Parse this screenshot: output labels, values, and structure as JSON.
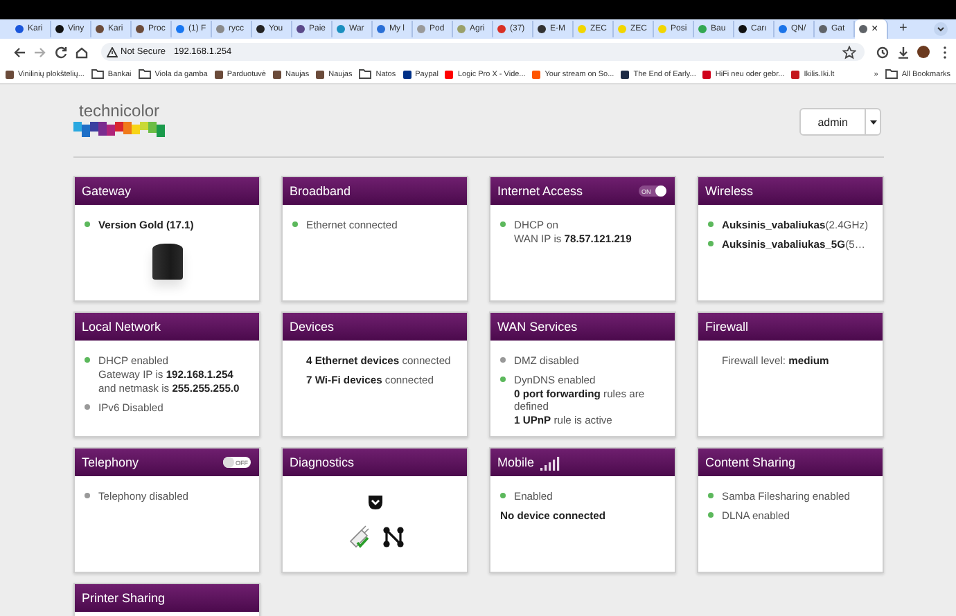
{
  "browser": {
    "tabs": [
      {
        "label": "Kari",
        "color": "#1a56db",
        "selected": false
      },
      {
        "label": "Viny",
        "color": "#111111",
        "selected": false
      },
      {
        "label": "Kari",
        "color": "#6b4b3a",
        "selected": false
      },
      {
        "label": "Proc",
        "color": "#6b4b3a",
        "selected": false
      },
      {
        "label": "(1) F",
        "color": "#1877f2",
        "selected": false
      },
      {
        "label": "rycc",
        "color": "#8a8a8a",
        "selected": false
      },
      {
        "label": "You",
        "color": "#222222",
        "selected": false
      },
      {
        "label": "Paie",
        "color": "#5b4a8a",
        "selected": false
      },
      {
        "label": "War",
        "color": "#1a8fbf",
        "selected": false
      },
      {
        "label": "My l",
        "color": "#2a6fd6",
        "selected": false
      },
      {
        "label": "Pod",
        "color": "#9a9a9a",
        "selected": false
      },
      {
        "label": "Agri",
        "color": "#9aa06a",
        "selected": false
      },
      {
        "label": "(37)",
        "color": "#d93025",
        "selected": false
      },
      {
        "label": "E-M",
        "color": "#333333",
        "selected": false
      },
      {
        "label": "ZEC",
        "color": "#f2d600",
        "selected": false
      },
      {
        "label": "ZEC",
        "color": "#f2d600",
        "selected": false
      },
      {
        "label": "Posi",
        "color": "#f2d600",
        "selected": false
      },
      {
        "label": "Bau",
        "color": "#34a853",
        "selected": false
      },
      {
        "label": "Carı",
        "color": "#111111",
        "selected": false
      },
      {
        "label": "QN/",
        "color": "#1a73e8",
        "selected": false
      },
      {
        "label": "Gat",
        "color": "#5f6368",
        "selected": false
      },
      {
        "color": "#5f6368",
        "close": "×",
        "selected": true
      }
    ],
    "new_tab": "+",
    "security": "Not Secure",
    "url": "192.168.1.254",
    "bookmarks": [
      {
        "label": "Vinilinių plokštelių...",
        "kind": "site",
        "color": "#6b4b3a"
      },
      {
        "label": "Bankai",
        "kind": "folder"
      },
      {
        "label": "Viola da gamba",
        "kind": "folder"
      },
      {
        "label": "Parduotuvė",
        "kind": "site",
        "color": "#6b4b3a"
      },
      {
        "label": "Naujas",
        "kind": "site",
        "color": "#6b4b3a"
      },
      {
        "label": "Naujas",
        "kind": "site",
        "color": "#6b4b3a"
      },
      {
        "label": "Natos",
        "kind": "folder"
      },
      {
        "label": "Paypal",
        "kind": "site",
        "color": "#003087"
      },
      {
        "label": "Logic Pro X - Vide...",
        "kind": "site",
        "color": "#ff0000"
      },
      {
        "label": "Your stream on So...",
        "kind": "site",
        "color": "#ff5500"
      },
      {
        "label": "The End of Early...",
        "kind": "site",
        "color": "#1c2a44"
      },
      {
        "label": "HiFi neu oder gebr...",
        "kind": "site",
        "color": "#d0021b"
      },
      {
        "label": "Ikilis.Iki.lt",
        "kind": "site",
        "color": "#c4161c"
      }
    ],
    "bookmarks_overflow": "»",
    "all_bookmarks": "All Bookmarks"
  },
  "header": {
    "logo": "technicolor",
    "user": "admin"
  },
  "cards": [
    {
      "title": "Gateway",
      "kind": "device",
      "items": [
        {
          "kind": "dot",
          "color": "#5cb85c",
          "text": "Version Gold (17.1)",
          "bold": true
        }
      ]
    },
    {
      "title": "Broadband",
      "kind": "status",
      "items": [
        {
          "kind": "dot",
          "color": "#5cb85c",
          "text": "Ethernet connected"
        }
      ]
    },
    {
      "title": "Internet Access",
      "kind": "status",
      "toggle": {
        "label": "ON",
        "on": true
      },
      "items": [
        {
          "kind": "dot",
          "color": "#5cb85c",
          "text": "DHCP on",
          "details": [
            "WAN IP is **78.57.121.219**"
          ]
        }
      ]
    },
    {
      "title": "Wireless",
      "kind": "status",
      "items": [
        {
          "kind": "dot",
          "color": "#5cb85c",
          "text": "**Auksinis_vabaliukas**(2.4GHz)"
        },
        {
          "kind": "dot",
          "color": "#5cb85c",
          "text": "**Auksinis_vabaliukas_5G**(5…"
        }
      ]
    },
    {
      "title": "Local Network",
      "kind": "status",
      "items": [
        {
          "kind": "dot",
          "color": "#5cb85c",
          "text": "DHCP enabled",
          "details": [
            "Gateway IP is **192.168.1.254**",
            "and netmask is **255.255.255.0**"
          ]
        },
        {
          "kind": "dot",
          "color": "#999999",
          "text": "IPv6 Disabled"
        }
      ]
    },
    {
      "title": "Devices",
      "kind": "status",
      "items": [
        {
          "kind": "indent",
          "text": "**4 Ethernet devices** connected"
        },
        {
          "kind": "indent",
          "text": "**7 Wi-Fi devices** connected"
        }
      ]
    },
    {
      "title": "WAN Services",
      "kind": "status",
      "items": [
        {
          "kind": "dot",
          "color": "#999999",
          "text": "DMZ disabled"
        },
        {
          "kind": "dot",
          "color": "#5cb85c",
          "text": "DynDNS enabled",
          "details": [
            "**0 port forwarding** rules are defined",
            "**1 UPnP** rule is active"
          ]
        }
      ]
    },
    {
      "title": "Firewall",
      "kind": "status",
      "items": [
        {
          "kind": "indent",
          "text": "Firewall level: **medium**"
        }
      ]
    },
    {
      "title": "Telephony",
      "kind": "status",
      "toggle": {
        "label": "OFF",
        "on": false
      },
      "items": [
        {
          "kind": "dot",
          "color": "#999999",
          "text": "Telephony disabled"
        }
      ]
    },
    {
      "title": "Diagnostics",
      "kind": "diagnostics"
    },
    {
      "title": "Mobile",
      "kind": "status",
      "signal_icon": true,
      "items": [
        {
          "kind": "dot",
          "color": "#5cb85c",
          "text": "Enabled"
        },
        {
          "kind": "flush",
          "text": "No device connected",
          "bold": true
        }
      ]
    },
    {
      "title": "Content Sharing",
      "kind": "status",
      "items": [
        {
          "kind": "dot",
          "color": "#5cb85c",
          "text": "Samba Filesharing enabled"
        },
        {
          "kind": "dot",
          "color": "#5cb85c",
          "text": "DLNA enabled"
        }
      ]
    },
    {
      "title": "Printer Sharing",
      "kind": "status"
    }
  ]
}
